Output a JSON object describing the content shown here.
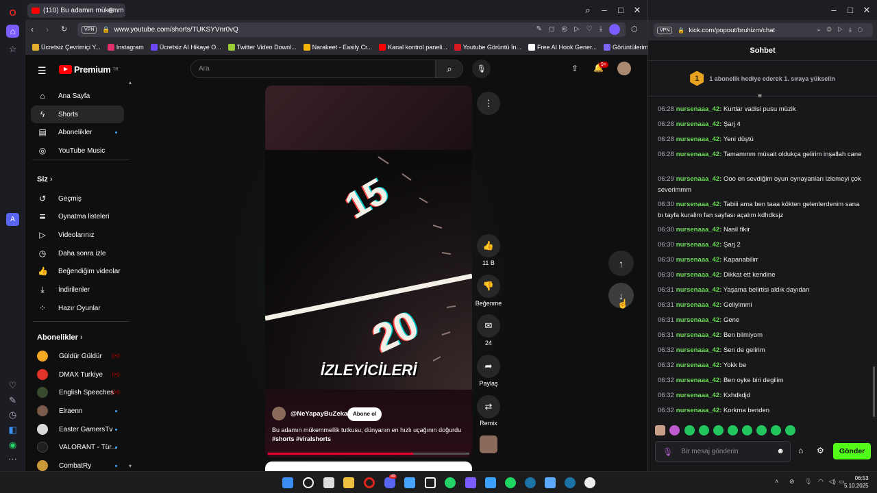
{
  "left_browser": {
    "tab_title": "(110) Bu adamın mükemm",
    "url": "www.youtube.com/shorts/TUKSYVnr0vQ",
    "vpn": "VPN",
    "bookmarks": [
      "Ücretsiz Çevrimiçi Y...",
      "Instagram",
      "Ücretsiz AI Hikaye O...",
      "Twitter Video Downl...",
      "Narakeet - Easily Cr...",
      "Kanal kontrol paneli...",
      "Youtube Görüntü İn...",
      "Free AI Hook Gener...",
      "Görüntülerim | LetsE..."
    ],
    "bookmark_colors": [
      "#e7ad33",
      "#e1306c",
      "#6c47ff",
      "#9acd32",
      "#f5b301",
      "#ff0000",
      "#d71920",
      "#ffffff",
      "#7b68ee"
    ]
  },
  "youtube": {
    "logo": "Premium",
    "logo_sup": "TR",
    "search_placeholder": "Ara",
    "notifications_badge": "9+",
    "nav": [
      {
        "label": "Ana Sayfa",
        "icon": "⌂"
      },
      {
        "label": "Shorts",
        "icon": "ϟ"
      },
      {
        "label": "Abonelikler",
        "icon": "▤"
      },
      {
        "label": "YouTube Music",
        "icon": "◎"
      }
    ],
    "you_heading": "Siz",
    "you_items": [
      {
        "label": "Geçmiş",
        "icon": "↺"
      },
      {
        "label": "Oynatma listeleri",
        "icon": "≣"
      },
      {
        "label": "Videolarınız",
        "icon": "▷"
      },
      {
        "label": "Daha sonra izle",
        "icon": "◷"
      },
      {
        "label": "Beğendiğim videolar",
        "icon": "👍"
      },
      {
        "label": "İndirilenler",
        "icon": "⤓"
      },
      {
        "label": "Hazır Oyunlar",
        "icon": "⁘"
      }
    ],
    "subs_heading": "Abonelikler",
    "subscriptions": [
      {
        "name": "Güldür Güldür",
        "color": "#f5a623"
      },
      {
        "name": "DMAX Turkiye",
        "color": "#e0332a"
      },
      {
        "name": "English Speeches",
        "color": "#3a4a2f"
      },
      {
        "name": "Elraenn",
        "color": "#7a5a4a"
      },
      {
        "name": "Easter GamersTv",
        "color": "#d9d9d9"
      },
      {
        "name": "VALORANT - Tür...",
        "color": "#1f1f1f"
      },
      {
        "name": "CombatRy",
        "color": "#c89a3a"
      }
    ],
    "short": {
      "overlay_text": "İZLEYİCİLERİ",
      "dial_a": "15",
      "dial_b": "20",
      "channel": "@NeYapayBuZeka",
      "subscribe": "Abone ol",
      "description": "Bu adamın mükemmellik tutkusu, dünyanın en hızlı uçağının doğurdu ",
      "hashtags": "#shorts #viralshorts",
      "like_count": "11 B",
      "dislike_label": "Beğenme",
      "comment_count": "24",
      "share_label": "Paylaş",
      "remix_label": "Remix",
      "progress": 0.72
    }
  },
  "right_browser": {
    "url": "kick.com/popout/bruhizm/chat",
    "vpn": "VPN",
    "chat_title": "Sohbet",
    "promo_badge": "1",
    "promo_text": "1 abonelik hediye ederek 1. sıraya yükselin",
    "messages": [
      {
        "time": "06:28",
        "user": "nursenaaa_42:",
        "text": "Kurtlar vadisi pusu müzik"
      },
      {
        "time": "06:28",
        "user": "nursenaaa_42:",
        "text": "Şarj 4"
      },
      {
        "time": "06:28",
        "user": "nursenaaa_42:",
        "text": "Yeni düştü"
      },
      {
        "time": "06:28",
        "user": "nursenaaa_42:",
        "text": "Tamammm müsait oldukça gelirim inşallah cane"
      },
      {
        "time": "06:29",
        "user": "nursenaaa_42:",
        "text": "Ooo en sevdiğim oyun oynayanları izlemeyi çok severimmm"
      },
      {
        "time": "06:30",
        "user": "nursenaaa_42:",
        "text": "Tabiii ama ben taaa kökten gelenlerdenim sana bı tayfa kuralim fan sayfası açalım kdhdksjz"
      },
      {
        "time": "06:30",
        "user": "nursenaaa_42:",
        "text": "Nasil fikir"
      },
      {
        "time": "06:30",
        "user": "nursenaaa_42:",
        "text": "Şarj 2"
      },
      {
        "time": "06:30",
        "user": "nursenaaa_42:",
        "text": "Kapanabilirr"
      },
      {
        "time": "06:30",
        "user": "nursenaaa_42:",
        "text": "Dikkat ett kendine"
      },
      {
        "time": "06:31",
        "user": "nursenaaa_42:",
        "text": "Yaşama belirtisi aldık dayıdan"
      },
      {
        "time": "06:31",
        "user": "nursenaaa_42:",
        "text": "Geliyimmi"
      },
      {
        "time": "06:31",
        "user": "nursenaaa_42:",
        "text": "Gene"
      },
      {
        "time": "06:31",
        "user": "nursenaaa_42:",
        "text": "Ben bilmiyom"
      },
      {
        "time": "06:32",
        "user": "nursenaaa_42:",
        "text": "Sen de gelirim"
      },
      {
        "time": "06:32",
        "user": "nursenaaa_42:",
        "text": "Yokk be"
      },
      {
        "time": "06:32",
        "user": "nursenaaa_42:",
        "text": "Ben oyke biri degilim"
      },
      {
        "time": "06:32",
        "user": "nursenaaa_42:",
        "text": "Kxhdkdjd"
      },
      {
        "time": "06:32",
        "user": "nursenaaa_42:",
        "text": "Korkma benden"
      }
    ],
    "input_placeholder": "Bir mesaj gönderin",
    "send_label": "Gönder"
  },
  "taskbar": {
    "time": "06:53",
    "date": "5.10.2025",
    "discord_badge": "49",
    "icons": [
      "windows-icon",
      "search-icon",
      "task-view-icon",
      "file-explorer-icon",
      "opera-icon",
      "discord-icon",
      "photos-icon",
      "capcut-icon",
      "whatsapp-icon",
      "obsidian-icon",
      "notepad-icon",
      "spotify-icon",
      "steam-icon",
      "app-icon",
      "steam-icon-2",
      "github-icon"
    ],
    "icon_colors": [
      "#3b8cf0",
      "#ffffff",
      "#dddddd",
      "#f0c040",
      "#e2261d",
      "#5865f2",
      "#48a3ff",
      "#ffffff",
      "#25d366",
      "#7c5cff",
      "#3aa0ff",
      "#1ed760",
      "#1b73a8",
      "#5aa9ff",
      "#1b73a8",
      "#eeeeee"
    ]
  }
}
